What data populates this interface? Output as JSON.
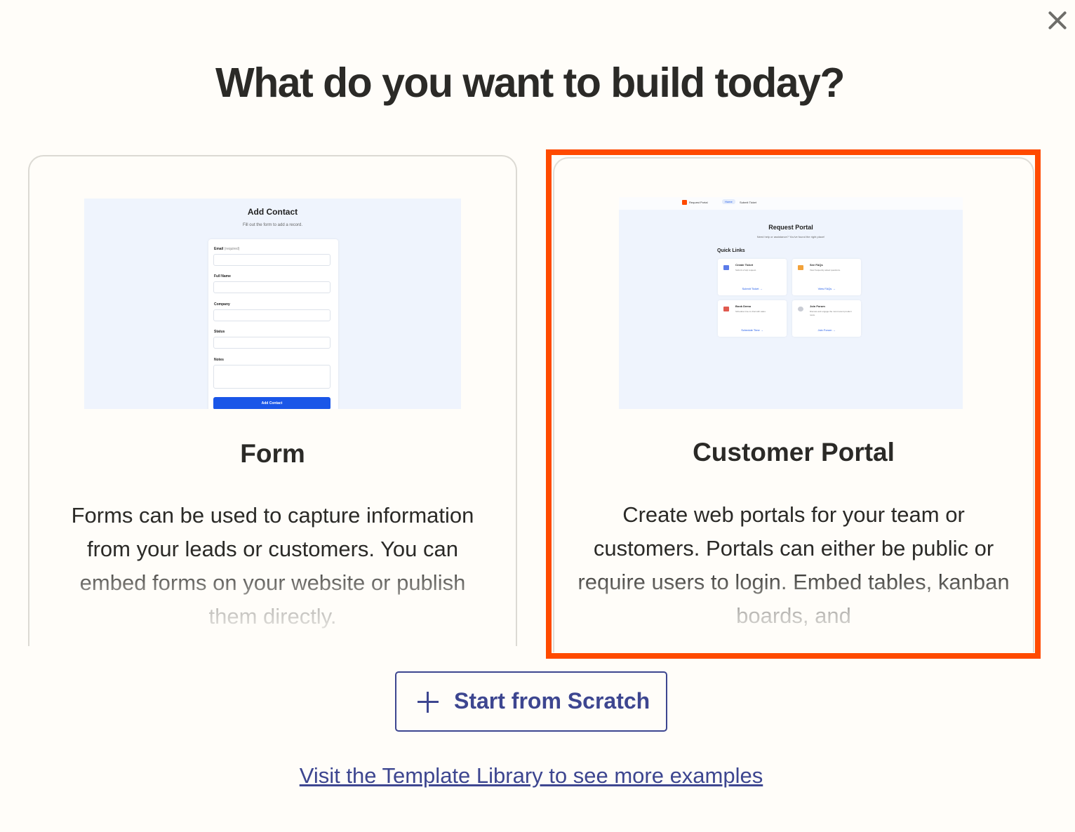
{
  "page_title": "What do you want to build today?",
  "close_label": "×",
  "cards": {
    "form": {
      "title": "Form",
      "description": "Forms can be used to capture information from your leads or customers. You can embed forms on your website or publish them directly.",
      "preview": {
        "title": "Add Contact",
        "subtitle": "Fill out the form to add a record.",
        "fields": [
          {
            "label": "Email",
            "note": "(required)"
          },
          {
            "label": "Full Name",
            "note": ""
          },
          {
            "label": "Company",
            "note": ""
          },
          {
            "label": "Status",
            "note": ""
          },
          {
            "label": "Notes",
            "note": ""
          }
        ],
        "button": "Add Contact"
      }
    },
    "portal": {
      "title": "Customer Portal",
      "description": "Create web portals for your team or customers. Portals can either be public or require users to login. Embed tables, kanban boards, and",
      "preview": {
        "nav_brand": "Request Portal",
        "nav_home": "Home",
        "nav_submit": "Submit Ticket",
        "title": "Request Portal",
        "subtitle": "Need help or assistance? You've found the right place!",
        "quick_links": "Quick Links",
        "tiles": [
          {
            "name": "Create Ticket",
            "desc": "Submit a help request.",
            "link": "Submit Ticket →",
            "color": "#5b7be9"
          },
          {
            "name": "See FAQs",
            "desc": "View frequently asked questions.",
            "link": "View FAQs →",
            "color": "#f2a23a"
          },
          {
            "name": "Book Demo",
            "desc": "Schedule time to chat with sales.",
            "link": "Schedule Time →",
            "color": "#e05a4f"
          },
          {
            "name": "Join Forum",
            "desc": "Discuss and engage the most recent product news.",
            "link": "Join Forum →",
            "color": "#c9ccd4"
          }
        ]
      }
    }
  },
  "scratch_button": "Start from Scratch",
  "template_link": "Visit the Template Library to see more examples",
  "colors": {
    "accent": "#3d4690",
    "highlight": "#ff4a00",
    "background": "#fffdf9"
  }
}
